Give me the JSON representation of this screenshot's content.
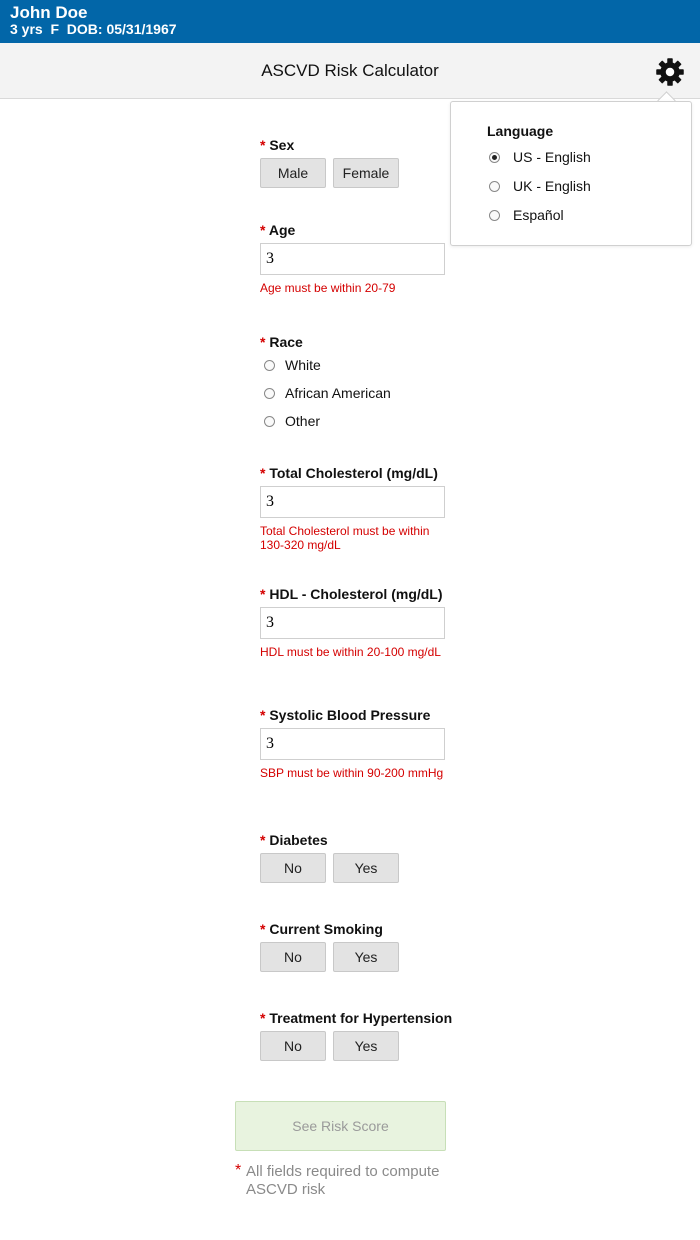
{
  "patient": {
    "name": "John Doe",
    "info": "3 yrs  F  DOB: 05/31/1967"
  },
  "header": {
    "title": "ASCVD Risk Calculator",
    "settings_icon": "gear-icon"
  },
  "language_menu": {
    "title": "Language",
    "selected": "US - English",
    "options": [
      "US - English",
      "UK - English",
      "Español"
    ]
  },
  "form": {
    "required_marker": "*",
    "sex": {
      "label": "Sex",
      "options": [
        "Male",
        "Female"
      ]
    },
    "age": {
      "label": "Age",
      "value": "3",
      "error": "Age must be within 20-79"
    },
    "race": {
      "label": "Race",
      "options": [
        "White",
        "African American",
        "Other"
      ]
    },
    "total_cholesterol": {
      "label": "Total Cholesterol (mg/dL)",
      "value": "3",
      "error": "Total Cholesterol must be within 130-320 mg/dL"
    },
    "hdl": {
      "label": "HDL - Cholesterol (mg/dL)",
      "value": "3",
      "error": "HDL must be within 20-100 mg/dL"
    },
    "sbp": {
      "label": "Systolic Blood Pressure",
      "value": "3",
      "error": "SBP must be within 90-200 mmHg"
    },
    "diabetes": {
      "label": "Diabetes",
      "options": [
        "No",
        "Yes"
      ]
    },
    "smoking": {
      "label": "Current Smoking",
      "options": [
        "No",
        "Yes"
      ]
    },
    "hypertension": {
      "label": "Treatment for Hypertension",
      "options": [
        "No",
        "Yes"
      ]
    }
  },
  "submit_label": "See Risk Score",
  "footnote": "All fields required to compute ASCVD risk",
  "colors": {
    "patient_bar": "#0266a8",
    "required": "#d40000",
    "error": "#d40000",
    "submit_bg": "#e8f3df"
  }
}
